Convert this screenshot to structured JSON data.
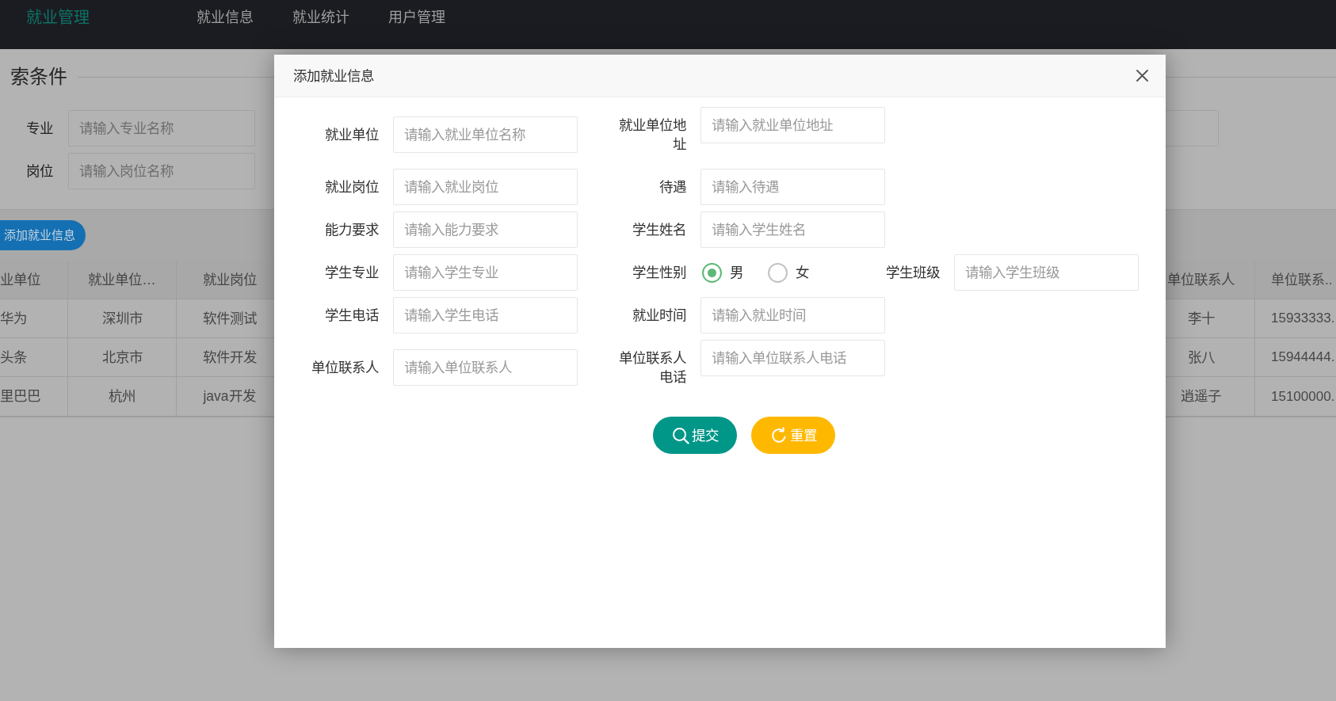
{
  "navbar": {
    "logo": "就业管理",
    "items": [
      "就业信息",
      "就业统计",
      "用户管理"
    ]
  },
  "search": {
    "title": "索条件",
    "fields": [
      {
        "kind": "labeled",
        "label": "专业",
        "placeholder": "请输入专业名称"
      },
      {
        "kind": "labeled",
        "label": "岗位",
        "placeholder": "请输入岗位名称"
      },
      {
        "kind": "covered"
      }
    ]
  },
  "add_button": "添加就业信息",
  "table": {
    "columns": [
      "业单位",
      "就业单位…",
      "就业岗位",
      "单位联系人",
      "单位联系.."
    ],
    "rows": [
      [
        "华为",
        "深圳市",
        "软件测试",
        "李十",
        "15933333."
      ],
      [
        "头条",
        "北京市",
        "软件开发",
        "张八",
        "15944444."
      ],
      [
        "里巴巴",
        "杭州",
        "java开发",
        "逍遥子",
        "15100000."
      ]
    ]
  },
  "dialog": {
    "title": "添加就业信息",
    "rows": [
      [
        {
          "kind": "input",
          "label": "就业单位",
          "placeholder": "请输入就业单位名称"
        },
        {
          "kind": "input",
          "label": "就业单位地址",
          "placeholder": "请输入就业单位地址"
        }
      ],
      [
        {
          "kind": "input",
          "label": "就业岗位",
          "placeholder": "请输入就业岗位"
        },
        {
          "kind": "input",
          "label": "待遇",
          "placeholder": "请输入待遇"
        }
      ],
      [
        {
          "kind": "input",
          "label": "能力要求",
          "placeholder": "请输入能力要求"
        },
        {
          "kind": "input",
          "label": "学生姓名",
          "placeholder": "请输入学生姓名"
        }
      ],
      [
        {
          "kind": "input",
          "label": "学生专业",
          "placeholder": "请输入学生专业"
        },
        {
          "kind": "radio",
          "label": "学生性别",
          "options": [
            {
              "label": "男",
              "selected": true
            },
            {
              "label": "女",
              "selected": false
            }
          ]
        },
        {
          "kind": "input",
          "label": "学生班级",
          "placeholder": "请输入学生班级"
        }
      ],
      [
        {
          "kind": "input",
          "label": "学生电话",
          "placeholder": "请输入学生电话"
        },
        {
          "kind": "input",
          "label": "就业时间",
          "placeholder": "请输入就业时间"
        }
      ],
      [
        {
          "kind": "input",
          "label": "单位联系人",
          "placeholder": "请输入单位联系人"
        },
        {
          "kind": "input",
          "label": "单位联系人电话",
          "placeholder": "请输入单位联系人电话"
        }
      ]
    ],
    "buttons": [
      {
        "kind": "submit",
        "label": "提交"
      },
      {
        "kind": "reset",
        "label": "重置"
      }
    ]
  }
}
